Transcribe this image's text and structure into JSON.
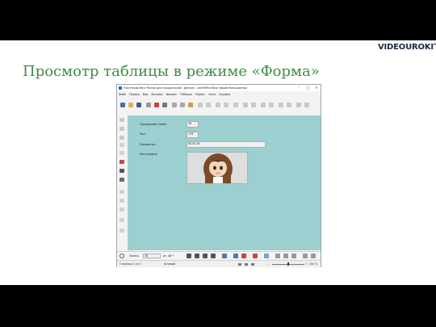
{
  "slide": {
    "title": "Просмотр таблицы в режиме «Форма»",
    "brand_main": "VIDEOUROKI",
    "brand_small": "net"
  },
  "window": {
    "title": "Участницы Мисс Россия для учащихся.odb : Данные - LibreOffice Base: форма базы данных",
    "controls": [
      "–",
      "□",
      "✕"
    ],
    "menu": [
      "Файл",
      "Правка",
      "Вид",
      "Вставка",
      "Формат",
      "Таблица",
      "Сервис",
      "Окно",
      "Справка"
    ]
  },
  "form": {
    "fields": [
      {
        "label": "Порядковый номер",
        "value": "38"
      },
      {
        "label": "Рост",
        "value": "178"
      },
      {
        "label": "Параметры",
        "value": "85-61-92"
      }
    ],
    "photo_label": "Фотография"
  },
  "navigation": {
    "record_label": "Запись",
    "record_value": "38",
    "of_label": "из",
    "total": "46 *"
  },
  "statusbar": {
    "page": "Страница 1 из 1",
    "style": "Базовый",
    "zoom": "100 %"
  },
  "colors": {
    "title_green": "#3d8c46",
    "form_background": "#9ccfcf"
  }
}
